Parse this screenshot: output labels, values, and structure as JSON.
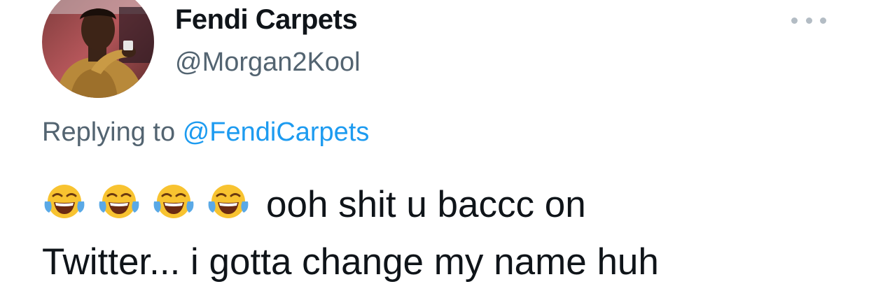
{
  "tweet": {
    "display_name": "Fendi Carpets",
    "handle": "@Morgan2Kool",
    "replying_label": "Replying to",
    "replying_to": "@FendiCarpets",
    "emoji": [
      "face-with-tears-of-joy",
      "face-with-tears-of-joy",
      "face-with-tears-of-joy",
      "face-with-tears-of-joy"
    ],
    "text_line1": "ooh shit u baccc on",
    "text_line2": "Twitter... i gotta change my name huh"
  },
  "icons": {
    "more": "more-horizontal-icon"
  },
  "colors": {
    "text_primary": "#0f1419",
    "text_secondary": "#536471",
    "link": "#1d9bf0",
    "more_dots": "#b3bcc4"
  }
}
